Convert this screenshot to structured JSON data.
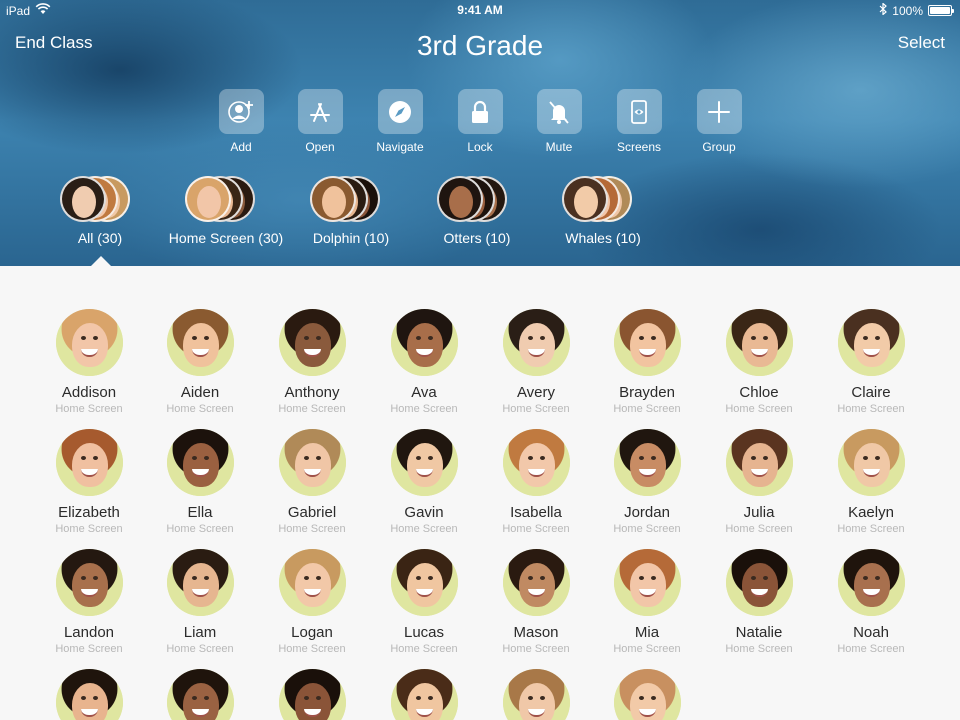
{
  "status_bar": {
    "device": "iPad",
    "time": "9:41 AM",
    "battery": "100%",
    "battery_level": 1.0
  },
  "header": {
    "left_button": "End Class",
    "title": "3rd Grade",
    "right_button": "Select"
  },
  "actions": [
    {
      "label": "Add",
      "icon": "add-student-icon"
    },
    {
      "label": "Open",
      "icon": "app-store-icon"
    },
    {
      "label": "Navigate",
      "icon": "compass-icon"
    },
    {
      "label": "Lock",
      "icon": "lock-icon"
    },
    {
      "label": "Mute",
      "icon": "bell-slash-icon"
    },
    {
      "label": "Screens",
      "icon": "screen-view-icon"
    },
    {
      "label": "Group",
      "icon": "plus-icon"
    }
  ],
  "groups": [
    {
      "label": "All (30)",
      "selected": true
    },
    {
      "label": "Home Screen (30)"
    },
    {
      "label": "Dolphin (10)"
    },
    {
      "label": "Otters (10)"
    },
    {
      "label": "Whales (10)"
    }
  ],
  "students": [
    {
      "name": "Addison",
      "status": "Home Screen",
      "skin": "#f2c6a8",
      "hair": "#d9a46a"
    },
    {
      "name": "Aiden",
      "status": "Home Screen",
      "skin": "#f0c29c",
      "hair": "#8a5a30"
    },
    {
      "name": "Anthony",
      "status": "Home Screen",
      "skin": "#8a5a3c",
      "hair": "#2a1a10"
    },
    {
      "name": "Ava",
      "status": "Home Screen",
      "skin": "#a86e4a",
      "hair": "#1f1510"
    },
    {
      "name": "Avery",
      "status": "Home Screen",
      "skin": "#f0ccb0",
      "hair": "#2a1e16"
    },
    {
      "name": "Brayden",
      "status": "Home Screen",
      "skin": "#f2c4a0",
      "hair": "#8a5530"
    },
    {
      "name": "Chloe",
      "status": "Home Screen",
      "skin": "#e9b994",
      "hair": "#3a2616"
    },
    {
      "name": "Claire",
      "status": "Home Screen",
      "skin": "#f2cba8",
      "hair": "#4a3020"
    },
    {
      "name": "Elizabeth",
      "status": "Home Screen",
      "skin": "#f0c0a0",
      "hair": "#a65a2e"
    },
    {
      "name": "Ella",
      "status": "Home Screen",
      "skin": "#9a6040",
      "hair": "#1c120c"
    },
    {
      "name": "Gabriel",
      "status": "Home Screen",
      "skin": "#f0c6a6",
      "hair": "#b08a58"
    },
    {
      "name": "Gavin",
      "status": "Home Screen",
      "skin": "#f0c8a4",
      "hair": "#20160f"
    },
    {
      "name": "Isabella",
      "status": "Home Screen",
      "skin": "#f2c8aa",
      "hair": "#c07a40"
    },
    {
      "name": "Jordan",
      "status": "Home Screen",
      "skin": "#c88c64",
      "hair": "#20160f"
    },
    {
      "name": "Julia",
      "status": "Home Screen",
      "skin": "#e6b490",
      "hair": "#5a3420"
    },
    {
      "name": "Kaelyn",
      "status": "Home Screen",
      "skin": "#f0c8a6",
      "hair": "#c89a60"
    },
    {
      "name": "Landon",
      "status": "Home Screen",
      "skin": "#a8704c",
      "hair": "#241810"
    },
    {
      "name": "Liam",
      "status": "Home Screen",
      "skin": "#e6b690",
      "hair": "#2a1c12"
    },
    {
      "name": "Logan",
      "status": "Home Screen",
      "skin": "#f2c8a8",
      "hair": "#c89a60"
    },
    {
      "name": "Lucas",
      "status": "Home Screen",
      "skin": "#f0c6a0",
      "hair": "#3a2414"
    },
    {
      "name": "Mason",
      "status": "Home Screen",
      "skin": "#c08a62",
      "hair": "#2a1a10"
    },
    {
      "name": "Mia",
      "status": "Home Screen",
      "skin": "#f2c6a8",
      "hair": "#b56a38"
    },
    {
      "name": "Natalie",
      "status": "Home Screen",
      "skin": "#8a5438",
      "hair": "#1a100a"
    },
    {
      "name": "Noah",
      "status": "Home Screen",
      "skin": "#a8704e",
      "hair": "#1f140c"
    },
    {
      "name": "",
      "status": "",
      "skin": "#e8b48e",
      "hair": "#1f140c"
    },
    {
      "name": "",
      "status": "",
      "skin": "#9a6242",
      "hair": "#1f140c"
    },
    {
      "name": "",
      "status": "",
      "skin": "#8a5438",
      "hair": "#1a100a"
    },
    {
      "name": "",
      "status": "",
      "skin": "#f0c6a0",
      "hair": "#4a2c18"
    },
    {
      "name": "",
      "status": "",
      "skin": "#f0c8a8",
      "hair": "#a87848"
    },
    {
      "name": "",
      "status": "",
      "skin": "#f2caa8",
      "hair": "#c89060"
    }
  ],
  "colors": {
    "avatar_ring": "#dfe6a0",
    "header_blue": "#3d83b0",
    "background": "#f7f7f7"
  }
}
